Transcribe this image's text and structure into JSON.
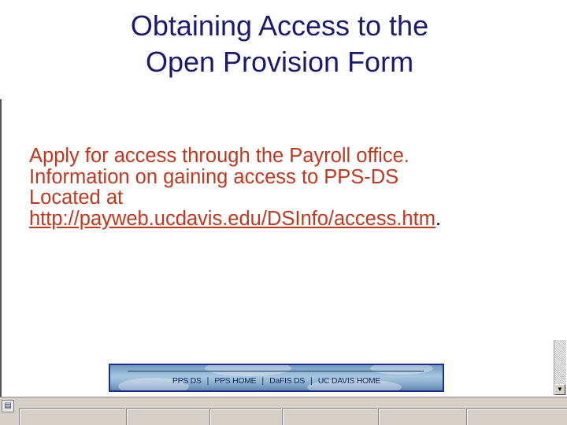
{
  "slide": {
    "title_lines": [
      "Obtaining Access to the",
      "Open Provision Form"
    ],
    "body_lines": [
      "Apply for access through the Payroll office.",
      "Information on gaining access to PPS-DS",
      "Located at"
    ],
    "link_text": "http://payweb.ucdavis.edu/DSInfo/access.htm",
    "link_trailing": "."
  },
  "nav_banner": {
    "links": [
      "PPS DS",
      "PPS HOME",
      "DaFIS DS",
      "UC DAVIS HOME"
    ],
    "separator": "|"
  },
  "status_bar": {
    "icon": "page-icon"
  },
  "colors": {
    "title": "#1a1a6e",
    "body_text": "#c0381e",
    "banner_border": "#1c2f8c",
    "banner_text": "#14265e"
  }
}
